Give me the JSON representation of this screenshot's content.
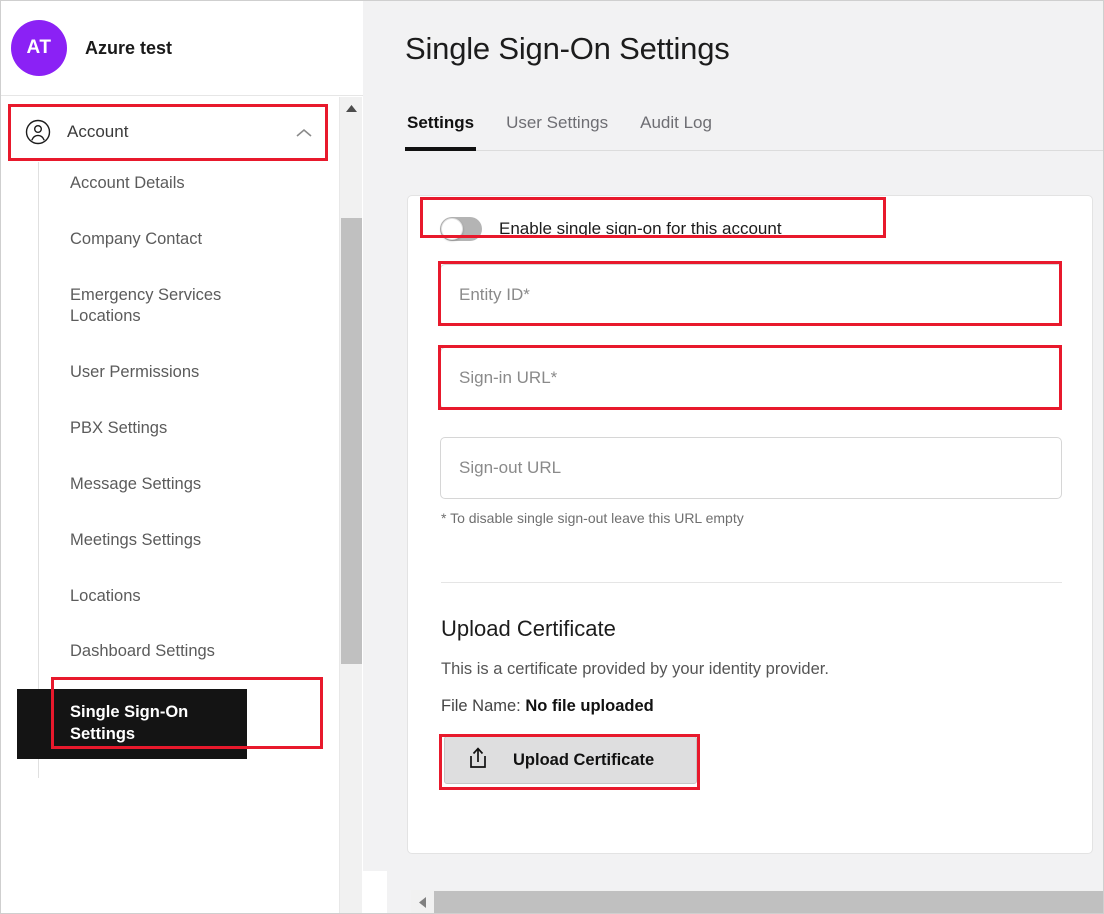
{
  "account": {
    "avatar_initials": "AT",
    "name": "Azure test",
    "avatar_color": "#8B21F5"
  },
  "sidebar": {
    "group": {
      "label": "Account",
      "icon": "account-circle-icon",
      "chevron": "chevron-up-icon",
      "expanded": true,
      "highlighted": true
    },
    "items": [
      {
        "label": "Account Details",
        "active": false
      },
      {
        "label": "Company Contact",
        "active": false
      },
      {
        "label": "Emergency Services Locations",
        "active": false
      },
      {
        "label": "User Permissions",
        "active": false
      },
      {
        "label": "PBX Settings",
        "active": false
      },
      {
        "label": "Message Settings",
        "active": false
      },
      {
        "label": "Meetings Settings",
        "active": false
      },
      {
        "label": "Locations",
        "active": false
      },
      {
        "label": "Dashboard Settings",
        "active": false
      },
      {
        "label": "Single Sign-On Settings",
        "active": true
      }
    ]
  },
  "main": {
    "title": "Single Sign-On Settings",
    "tabs": [
      {
        "label": "Settings",
        "active": true
      },
      {
        "label": "User Settings",
        "active": false
      },
      {
        "label": "Audit Log",
        "active": false
      }
    ],
    "sso": {
      "toggle_label": "Enable single sign-on for this account",
      "toggle_on": false,
      "fields": [
        {
          "placeholder": "Entity ID*",
          "value": ""
        },
        {
          "placeholder": "Sign-in URL*",
          "value": ""
        },
        {
          "placeholder": "Sign-out URL",
          "value": ""
        }
      ],
      "helper_text": "* To disable single sign-out leave this URL empty"
    },
    "certificate": {
      "title": "Upload Certificate",
      "description": "This is a certificate provided by your identity provider.",
      "file_label": "File Name:",
      "file_value": "No file uploaded",
      "button_label": "Upload Certificate",
      "button_icon": "upload-tray-icon"
    }
  },
  "annotations": {
    "highlight_color": "#E8192C"
  }
}
